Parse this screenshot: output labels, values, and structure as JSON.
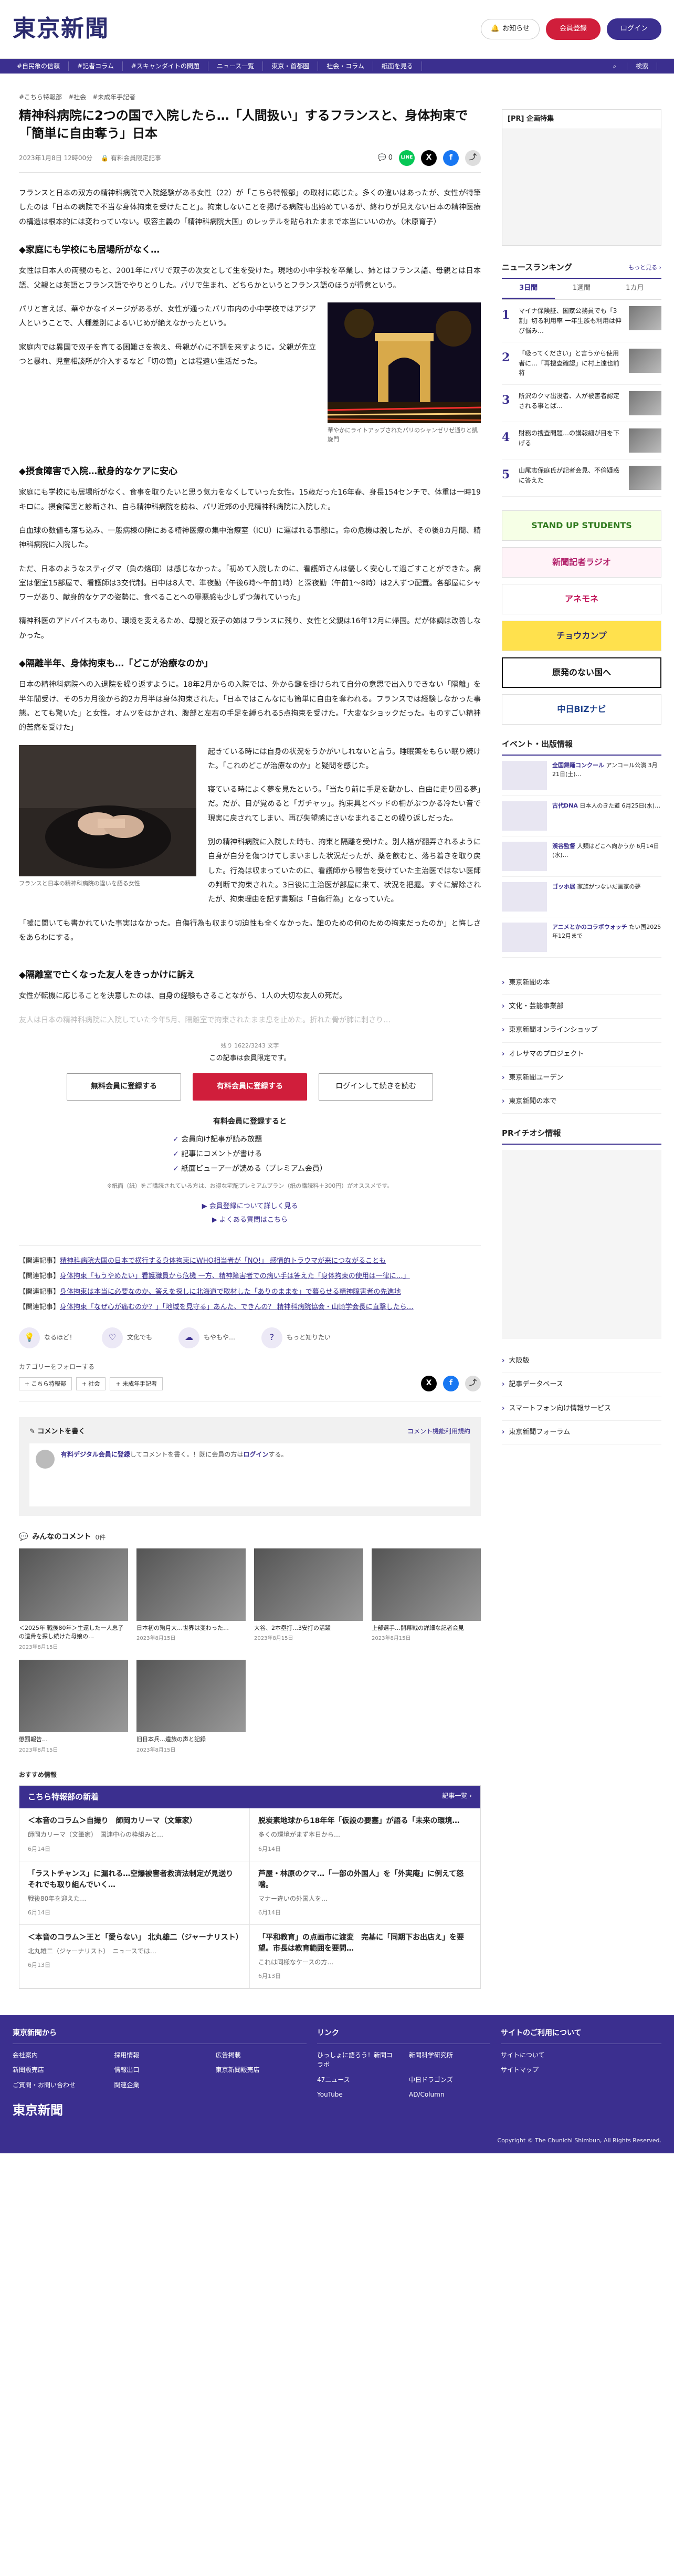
{
  "header": {
    "logo": "東京新聞",
    "notify_label": "お知らせ",
    "register_label": "会員登録",
    "login_label": "ログイン"
  },
  "nav": [
    "#自民象の信頼",
    "#記者コラム",
    "#スキャンダイトの問題",
    "ニュース一覧",
    "東京・首都圏",
    "社会・コラム",
    "紙面を見る",
    "検索"
  ],
  "article": {
    "tags": [
      "#こちら特報部",
      "#社会",
      "#未成年手記者"
    ],
    "title": "精神科病院に2つの国で入院したら…「人間扱い」するフランスと、身体拘束で「簡単に自由奪う」日本",
    "date": "2023年1月8日 12時00分",
    "badge": "有料会員限定記事",
    "comment_count": "0",
    "paragraphs_1": [
      "フランスと日本の双方の精神科病院で入院経験がある女性（22）が「こちら特報部」の取材に応じた。多くの違いはあったが、女性が特筆したのは「日本の病院で不当な身体拘束を受けたこと」。拘束しないことを掲げる病院も出始めているが、終わりが見えない日本の精神医療の構造は根本的には変わっていない。収容主義の「精神科病院大国」のレッテルを貼られたままで本当にいいのか。（木原育子）"
    ],
    "h_1": "◆家庭にも学校にも居場所がなく…",
    "paragraphs_2": [
      "女性は日本人の両親のもと、2001年にパリで双子の次女として生を受けた。現地の小中学校を卒業し、姉とはフランス語、母親とは日本語、父親とは英語とフランス語でやりとりした。パリで生まれ、どちらかというとフランス語のほうが得意という。",
      "パリと言えば、華やかなイメージがあるが、女性が通ったパリ市内の小中学校ではアジア人ということで、人種差別によるいじめが絶えなかったという。",
      "家庭内では異国で双子を育てる困難さを抱え、母親が心に不調を来すように。父親が先立つと暴れ、児童相談所が介入するなど「切の筒」とは程遠い生活だった。"
    ],
    "fig1_caption": "華やかにライトアップされたパリのシャンゼリゼ通りと凱旋門",
    "h_2": "◆摂食障害で入院…献身的なケアに安心",
    "paragraphs_3": [
      "家庭にも学校にも居場所がなく、食事を取りたいと思う気力をなくしていった女性。15歳だった16年春、身長154センチで、体重は一時19キロに。摂食障害と診断され、自ら精神科病院を訪ね、パリ近郊の小児精神科病院に入院した。",
      "白血球の数値も落ち込み、一般病棟の隣にある精神医療の集中治療室（ICU）に運ばれる事態に。命の危機は脱したが、その後8カ月間、精神科病院に入院した。",
      "ただ、日本のようなスティグマ（負の烙印）は感じなかった。「初めて入院したのに、看護師さんは優しく安心して過ごすことができた。病室は個室15部屋で、看護師は3交代制。日中は8人で、準夜勤（午後6時〜午前1時）と深夜勤（午前1〜8時）は2人ずつ配置。各部屋にシャワーがあり、献身的なケアの姿勢に、食べることへの罪悪感も少しずつ薄れていった」",
      "精神科医のアドバイスもあり、環境を変えるため、母親と双子の姉はフランスに残り、女性と父親は16年12月に帰国。だが体調は改善しなかった。"
    ],
    "h_3": "◆隔離半年、身体拘束も…「どこが治療なのか」",
    "paragraphs_4": [
      "日本の精神科病院への入退院を繰り返すように。18年2月からの入院では、外から鍵を掛けられて自分の意思で出入りできない「隔離」を半年間受け、その5カ月後から約2カ月半は身体拘束された。「日本ではこんなにも簡単に自由を奪われる。フランスでは経験しなかった事態。とても驚いた」と女性。オムツをはかされ、腹部と左右の手足を縛られる5点拘束を受けた。「大変なショックだった。ものすごい精神的苦痛を受けた」"
    ],
    "paragraphs_5": [
      "起きている時には自身の状況をうかがいしれないと言う。睡眠薬をもらい眠り続けた。「これのどこが治療なのか」と疑問を感じた。",
      "寝ている時によく夢を見たという。「当たり前に手足を動かし、自由に走り回る夢」だ。だが、目が覚めると「ガチャッ」。拘束具とベッドの柵がぶつかる冷たい音で現実に戻されてしまい、再び失望感にさいなまれることの繰り返しだった。",
      "別の精神科病院に入院した時も、拘束と隔離を受けた。別人格が翻弄されるように自身が自分を傷つけてしまいました状況だったが、薬を飲むと、落ち着きを取り戻した。行為は収まっていたのに、看護師から報告を受けていた主治医ではない医師の判断で拘束された。3日後に主治医が部屋に来て、状況を把握。すぐに解除されたが、拘束理由を記す書類は「自傷行為」となっていた。",
      "「嘘に聞いても書かれていた事実はなかった。自傷行為も収まり切迫性も全くなかった。誰のための何のための拘束だったのか」と悔しさをあらわにする。"
    ],
    "fig2_caption": "フランスと日本の精神科病院の違いを語る女性",
    "h_4": "◆隔離室で亡くなった友人をきっかけに訴え",
    "paragraphs_6": [
      "女性が転機に応じることを決意したのは、自身の経験もさることながら、1人の大切な友人の死だ。"
    ],
    "fade_text": "友人は日本の精神科病院に入院していた今年5月、隔離室で拘束されたまま息を止めた。折れた骨が肺に刺さり…"
  },
  "paywall": {
    "char_count": "残り 1622/3243 文字",
    "note": "この記事は会員限定です。",
    "free_btn": "無料会員に登録する",
    "paid_btn": "有料会員に登録する",
    "login_btn": "ログインして続きを読む",
    "benefit_title": "有料会員に登録すると",
    "benefits": [
      "会員向け記事が読み放題",
      "記事にコメントが書ける",
      "紙面ビューアーが読める（プレミアム会員）"
    ],
    "small": "※紙面（紙）をご購読されている方は、お得な宅配プレミアムプラン（紙の購読料＋300円）がオススメです。",
    "link_about": "▶ 会員登録について詳しく見る",
    "link_faq": "▶ よくある質問はこちら"
  },
  "related": [
    {
      "label": "【関連記事】",
      "text": "精神科病院大国の日本で横行する身体拘束にWHO相当者が「NO!」 感情的トラウマが来につながることも"
    },
    {
      "label": "【関連記事】",
      "text": "身体拘束「もうやめたい」看護職員から危機 一方、精神障害者での病い手は答えた「身体拘束の使用は一律に…」"
    },
    {
      "label": "【関連記事】",
      "text": "身体拘束は本当に必要なのか、答えを探しに北海道で取材した「ありのままを」で暮らせる精神障害者の先進地"
    },
    {
      "label": "【関連記事】",
      "text": "身体拘束「なぜ心が痛むのか？」「地域を見守る」あんた、できんの？ 精神科病院協会・山崎学会長に直撃したら…"
    }
  ],
  "reactions": [
    "なるほど！",
    "文化でも",
    "もやもや…",
    "もっと知りたい"
  ],
  "follow": {
    "title": "カテゴリーをフォローする",
    "tags": [
      "+ こちら特報部",
      "+ 社会",
      "+ 未成年手記者"
    ]
  },
  "comment": {
    "title": "コメントを書く",
    "rule": "コメント機能利用規約",
    "prompt_link": "有料デジタル会員に登録",
    "prompt_text": "してコメントを書く。！既に会員の方は",
    "login_link": "ログイン",
    "prompt_end": "する。"
  },
  "minna": {
    "title": "みんなのコメント",
    "count": "0件",
    "items": [
      {
        "t": "＜2025年 戦後80年＞生還した一人息子の遺骨を探し続けた母娘の…",
        "d": "2023年8月15日"
      },
      {
        "t": "日本初の殉月大…世界は変わった…",
        "d": "2023年8月15日"
      },
      {
        "t": "大谷、2本塁打…3安打の活躍",
        "d": "2023年8月15日"
      },
      {
        "t": "上部選手…開幕戦の詳細な記者会見",
        "d": "2023年8月15日"
      },
      {
        "t": "懲罰報告…",
        "d": "2023年8月15日"
      },
      {
        "t": "旧日本兵…遺族の声と記録",
        "d": "2023年8月15日"
      }
    ]
  },
  "osusume": "おすすめ情報",
  "series": {
    "title": "こちら特報部の新着",
    "more": "記事一覧 ›",
    "items": [
      {
        "t": "＜本音のコラム＞自撮り　師岡カリーマ（文筆家）",
        "d": "師岡カリーマ（文筆家）　国連中心の枠組みと…",
        "date": "6月14日"
      },
      {
        "t": "脱炭素地球から18年年「仮設の要塞」が語る「未来の環境…",
        "d": "多くの環境がまず本日から…",
        "date": "6月14日"
      },
      {
        "t": "「ラストチャンス」に漏れる…空爆被害者救済法制定が見送り　それでも取り組んでいく…",
        "d": "戦後80年を迎えた…",
        "date": "6月14日"
      },
      {
        "t": "芦屋・林原のクマ…「一部の外国人」を「外実庵」に例えて怒噛。",
        "d": "マナー違いの外国人を…",
        "date": "6月14日"
      },
      {
        "t": "＜本音のコラム＞王と「愛らない」 北丸雄二（ジャーナリスト）",
        "d": "北丸雄二（ジャーナリスト）　ニュースでは…",
        "date": "6月13日"
      },
      {
        "t": "「平和教育」の点画市に渡変　完基に「同期下お出店え」を要望。市長は教育範囲を要問…",
        "d": "これは同様なケースの方…",
        "date": "6月13日"
      }
    ]
  },
  "sidebar": {
    "ad_label": "[PR] 企画特集",
    "ranking_title": "ニュースランキング",
    "ranking_more": "もっと見る ›",
    "tabs": [
      "3日間",
      "1週間",
      "1カ月"
    ],
    "ranking": [
      "マイナ保険証、国家公務員でも「3割」切る利用率 一年生族も利用は伸び悩み…",
      "「吸ってください」と言うから使用者に…「再捜査確認」に村上達也前将",
      "所沢のクマ出没者、人が被害者認定される事とば…",
      "財務の捜査問題…の講報細が目を下げる",
      "山尾志保庭氏が記者会見、不倫疑惑に答えた"
    ],
    "banners": [
      "STAND UP STUDENTS",
      "新聞記者ラジオ",
      "アネモネ",
      "チョウカンプ",
      "原発のない国へ",
      "中日BiZナビ"
    ],
    "events_title": "イベント・出版情報",
    "events": [
      {
        "b": "全国舞踊コンクール",
        "t": "アンコール公演 3月21日(土)…"
      },
      {
        "b": "古代DNA",
        "t": "日本人のきた道 6月25日(水)…"
      },
      {
        "b": "渓谷監督",
        "t": "人類はどこへ向かうか 6月14日(水)…"
      },
      {
        "b": "ゴッホ展",
        "t": "家族がつないだ画家の夢"
      },
      {
        "b": "アニメとかのコラボウォッチ",
        "t": "たい国2025年12月まで"
      }
    ],
    "list1": [
      "東京新聞の本",
      "文化・芸能事業部",
      "東京新聞オンラインショップ",
      "オレサマのプロジェクト",
      "東京新聞ユーデン",
      "東京新聞の本で"
    ],
    "pr_title": "PRイチオシ情報",
    "list2": [
      "大阪版",
      "記事データベース",
      "スマートフォン向け情報サービス",
      "東京新聞フォーラム"
    ]
  },
  "footer": {
    "c1_title": "東京新聞から",
    "c1": [
      "会社案内",
      "採用情報",
      "広告掲載",
      "新聞販売店",
      "情報出口",
      "東京新聞販売店",
      "ご質問・お問い合わせ",
      "関連企業"
    ],
    "c2_title": "リンク",
    "c2": [
      "ひっしょに語ろう！新聞コラボ",
      "新聞科学研究所",
      "47ニュース",
      "中日ドラゴンズ",
      "YouTube",
      "AD/Column"
    ],
    "c3_title": "サイトのご利用について",
    "c3": [
      "サイトについて",
      "サイトマップ"
    ],
    "copyright": "Copyright © The Chunichi Shimbun, All Rights Reserved."
  }
}
